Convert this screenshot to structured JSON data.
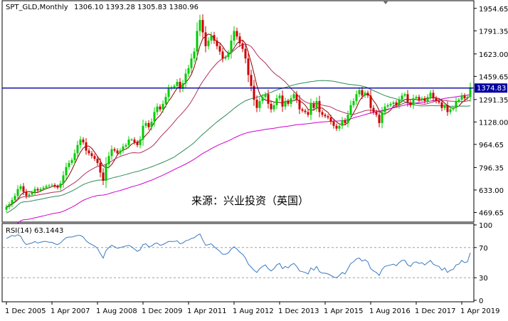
{
  "chart_data": [
    {
      "type": "candlestick",
      "title": "SPT_GLD,Monthly",
      "ohlc_text": "1306.10 1393.28 1305.83 1380.96",
      "source_text": "来源：兴业投资（英国）",
      "ylim": [
        410,
        2000
      ],
      "yticks": [
        "1954.65",
        "1791.35",
        "1623.00",
        "1459.65",
        "1291.35",
        "1128.00",
        "964.65",
        "796.35",
        "633.00",
        "469.65"
      ],
      "current_price": 1374.83,
      "current_price_label": "1374.83",
      "x_labels": [
        "1 Dec 2005",
        "1 Apr 2007",
        "1 Aug 2008",
        "1 Dec 2009",
        "1 Apr 2011",
        "1 Aug 2012",
        "1 Dec 2013",
        "1 Apr 2015",
        "1 Aug 2016",
        "1 Dec 2017",
        "1 Apr 2019"
      ],
      "x_label_indices": [
        0,
        16,
        32,
        48,
        64,
        80,
        96,
        112,
        128,
        144,
        160
      ],
      "bull_color": "#00cc00",
      "bear_color": "#cc0000",
      "series": [
        {
          "color": "#8b0000",
          "period": 5
        },
        {
          "color": "#b03060",
          "period": 20
        },
        {
          "color": "#2e8b57",
          "period": 60
        },
        {
          "color": "#d000d0",
          "period": 120
        }
      ],
      "closes": [
        510,
        530,
        560,
        590,
        640,
        660,
        620,
        590,
        600,
        615,
        640,
        630,
        640,
        650,
        660,
        665,
        670,
        660,
        650,
        680,
        740,
        800,
        830,
        850,
        900,
        960,
        1000,
        980,
        920,
        900,
        880,
        860,
        830,
        760,
        700,
        820,
        880,
        930,
        920,
        900,
        920,
        950,
        960,
        1000,
        1000,
        980,
        960,
        1000,
        1100,
        1120,
        1090,
        1130,
        1200,
        1240,
        1220,
        1260,
        1310,
        1370,
        1380,
        1390,
        1420,
        1370,
        1410,
        1480,
        1520,
        1590,
        1640,
        1790,
        1870,
        1780,
        1680,
        1720,
        1760,
        1720,
        1680,
        1640,
        1590,
        1600,
        1630,
        1720,
        1790,
        1750,
        1700,
        1660,
        1590,
        1470,
        1390,
        1290,
        1230,
        1280,
        1310,
        1330,
        1260,
        1220,
        1250,
        1300,
        1320,
        1240,
        1280,
        1260,
        1300,
        1330,
        1290,
        1220,
        1210,
        1200,
        1180,
        1260,
        1230,
        1280,
        1200,
        1180,
        1170,
        1160,
        1130,
        1100,
        1080,
        1100,
        1140,
        1120,
        1180,
        1250,
        1280,
        1330,
        1360,
        1320,
        1340,
        1320,
        1230,
        1200,
        1180,
        1120,
        1200,
        1240,
        1250,
        1260,
        1270,
        1250,
        1290,
        1320,
        1330,
        1270,
        1250,
        1300,
        1310,
        1290,
        1300,
        1280,
        1310,
        1340,
        1300,
        1280,
        1270,
        1230,
        1250,
        1200,
        1220,
        1230,
        1280,
        1290,
        1320,
        1300,
        1310,
        1380
      ],
      "rsi": {
        "label": "RSI(14) 63.1443",
        "ylim": [
          0,
          100
        ],
        "yticks": [
          100,
          70,
          30,
          0
        ],
        "levels": [
          70,
          30
        ],
        "color": "#3a7abf",
        "values": [
          82,
          84,
          86,
          85,
          87,
          85,
          78,
          74,
          75,
          76,
          78,
          76,
          77,
          78,
          78,
          77,
          77,
          75,
          74,
          76,
          80,
          83,
          84,
          84,
          85,
          86,
          86,
          84,
          79,
          76,
          74,
          72,
          69,
          62,
          56,
          66,
          70,
          73,
          71,
          69,
          70,
          71,
          72,
          73,
          71,
          68,
          65,
          67,
          74,
          75,
          71,
          72,
          75,
          76,
          73,
          74,
          76,
          78,
          78,
          78,
          79,
          75,
          76,
          79,
          80,
          82,
          83,
          86,
          88,
          80,
          73,
          74,
          75,
          71,
          68,
          65,
          61,
          61,
          63,
          68,
          71,
          68,
          64,
          61,
          56,
          48,
          44,
          40,
          37,
          42,
          45,
          47,
          42,
          39,
          42,
          47,
          49,
          42,
          45,
          43,
          47,
          49,
          45,
          39,
          38,
          37,
          35,
          43,
          40,
          45,
          38,
          36,
          36,
          35,
          33,
          31,
          30,
          33,
          37,
          35,
          42,
          49,
          51,
          55,
          56,
          52,
          54,
          51,
          42,
          39,
          37,
          33,
          41,
          45,
          46,
          47,
          48,
          46,
          50,
          53,
          53,
          47,
          45,
          50,
          51,
          49,
          50,
          47,
          50,
          53,
          48,
          46,
          45,
          40,
          43,
          37,
          40,
          41,
          47,
          48,
          53,
          50,
          51,
          63
        ]
      }
    }
  ]
}
